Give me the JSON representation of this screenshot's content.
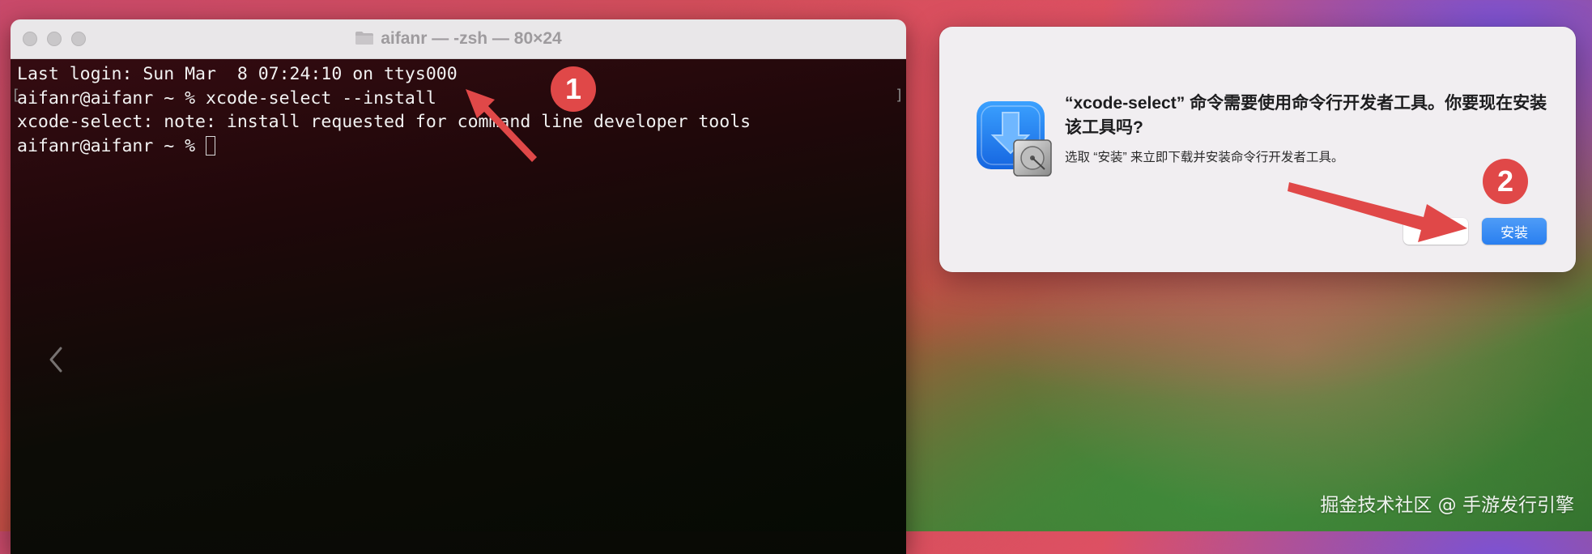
{
  "terminal": {
    "title": "aifanr — -zsh — 80×24",
    "lines": [
      "Last login: Sun Mar  8 07:24:10 on ttys000",
      "aifanr@aifanr ~ % xcode-select --install",
      "xcode-select: note: install requested for command line developer tools",
      "aifanr@aifanr ~ % "
    ]
  },
  "dialog": {
    "title": "“xcode-select” 命令需要使用命令行开发者工具。你要现在安装该工具吗?",
    "info": "选取 “安装” 来立即下载并安装命令行开发者工具。",
    "install_label": "安装",
    "cancel_label": ""
  },
  "annotations": {
    "badge_1": "1",
    "badge_2": "2",
    "color": "#e04848"
  },
  "watermark": "掘金技术社区 @ 手游发行引擎",
  "icons": {
    "folder": "folder-icon",
    "installer": "xcode-installer-icon",
    "back": "chevron-left-icon"
  }
}
